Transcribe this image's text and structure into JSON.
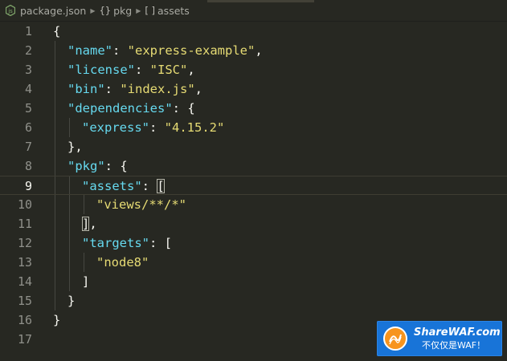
{
  "breadcrumb": {
    "file": "package.json",
    "symbol1": "pkg",
    "symbol1_icon": "{}",
    "symbol2": "assets",
    "symbol2_icon": "[ ]"
  },
  "editor": {
    "current_line": 9,
    "lines": [
      {
        "n": "1"
      },
      {
        "n": "2"
      },
      {
        "n": "3"
      },
      {
        "n": "4"
      },
      {
        "n": "5"
      },
      {
        "n": "6"
      },
      {
        "n": "7"
      },
      {
        "n": "8"
      },
      {
        "n": "9"
      },
      {
        "n": "10"
      },
      {
        "n": "11"
      },
      {
        "n": "12"
      },
      {
        "n": "13"
      },
      {
        "n": "14"
      },
      {
        "n": "15"
      },
      {
        "n": "16"
      },
      {
        "n": "17"
      }
    ],
    "tokens": {
      "brace_open": "{",
      "brace_close": "}",
      "name_key": "\"name\"",
      "name_val": "\"express-example\"",
      "license_key": "\"license\"",
      "license_val": "\"ISC\"",
      "bin_key": "\"bin\"",
      "bin_val": "\"index.js\"",
      "deps_key": "\"dependencies\"",
      "express_key": "\"express\"",
      "express_val": "\"4.15.2\"",
      "pkg_key": "\"pkg\"",
      "assets_key": "\"assets\"",
      "assets_val": "\"views/**/*\"",
      "targets_key": "\"targets\"",
      "targets_val": "\"node8\"",
      "colon": ": ",
      "comma": ",",
      "bracket_open": "[",
      "bracket_close": "]",
      "brace_close_comma": "},"
    }
  },
  "watermark": {
    "title": "ShareWAF.com",
    "subtitle": "不仅仅是WAF！"
  },
  "colors": {
    "background": "#272822",
    "key": "#66d9ef",
    "string": "#e6db74",
    "punctuation": "#f8f8f2",
    "line_number": "#8f908a",
    "watermark_bg": "#1874d8",
    "watermark_logo": "#f7941d"
  }
}
